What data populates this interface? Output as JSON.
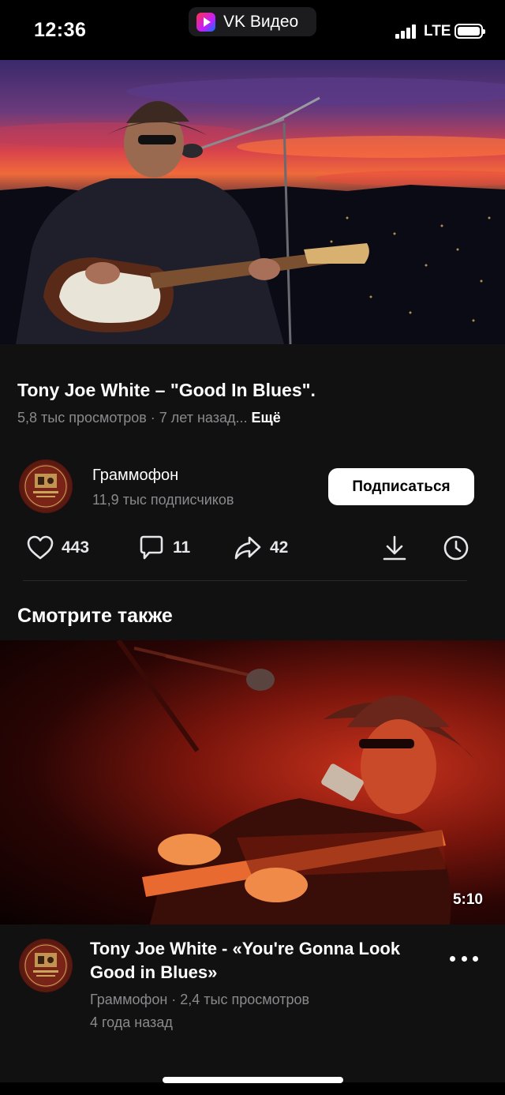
{
  "status_bar": {
    "time": "12:36",
    "app_name": "VK Видео",
    "network": "LTE",
    "icons": [
      "signal-icon",
      "battery-icon"
    ]
  },
  "video": {
    "title": "Tony Joe White – \"Good In Blues\".",
    "views": "5,8 тыс просмотров",
    "separator": " · ",
    "age": "7 лет назад...",
    "more_label": "Ещё"
  },
  "channel": {
    "name": "Граммофон",
    "subscribers": "11,9 тыс подписчиков",
    "subscribe_label": "Подписаться"
  },
  "actions": {
    "likes": "443",
    "comments": "11",
    "shares": "42",
    "icons": [
      "heart-icon",
      "comment-icon",
      "share-icon",
      "download-icon",
      "watch-later-icon"
    ]
  },
  "section": {
    "title": "Смотрите также"
  },
  "recommendation": {
    "duration": "5:10",
    "title": "Tony Joe White - «You're Gonna Look Good in Blues»",
    "channel": "Граммофон",
    "separator": " · ",
    "views": "2,4 тыс просмотров",
    "age": "4 года назад"
  },
  "colors": {
    "background": "#000000",
    "surface": "#111111",
    "secondary_text": "#8a8a8e",
    "button_bg": "#ffffff"
  }
}
